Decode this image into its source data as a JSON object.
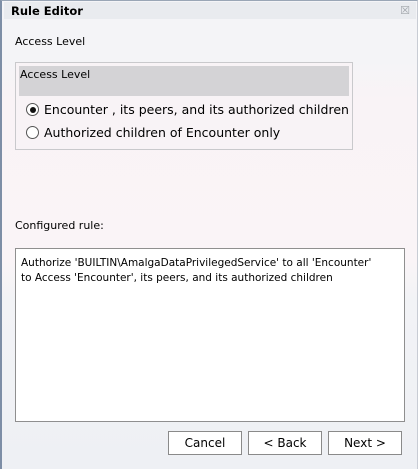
{
  "window": {
    "title": "Rule Editor",
    "close_icon": "close-icon"
  },
  "section_label": "Access Level",
  "group": {
    "header": "Access Level",
    "options": [
      {
        "label": "Encounter , its peers, and its authorized children",
        "selected": true
      },
      {
        "label": "Authorized children of Encounter only",
        "selected": false
      }
    ]
  },
  "configured": {
    "label": "Configured rule:",
    "text": "Authorize 'BUILTIN\\AmalgaDataPrivilegedService' to all 'Encounter'\nto Access 'Encounter', its peers, and its authorized children"
  },
  "buttons": {
    "cancel": "Cancel",
    "back": "< Back",
    "next": "Next >"
  }
}
